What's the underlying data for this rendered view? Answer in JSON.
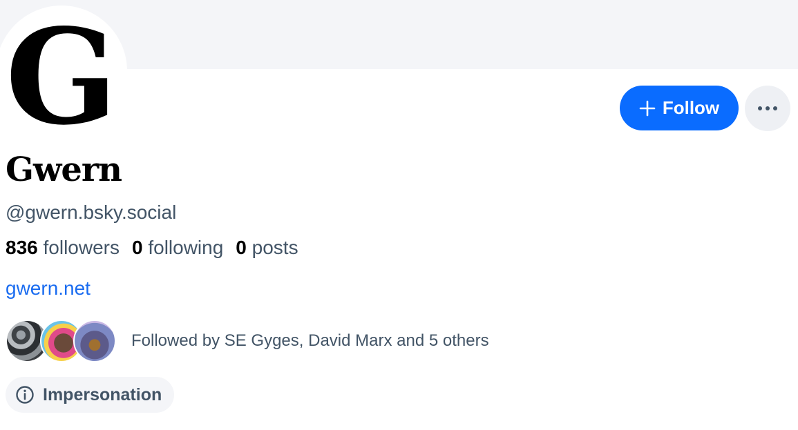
{
  "profile": {
    "display_name": "Gwern",
    "avatar_letter": "G",
    "handle": "@gwern.bsky.social",
    "website": "gwern.net"
  },
  "stats": {
    "followers_count": "836",
    "followers_label": "followers",
    "following_count": "0",
    "following_label": "following",
    "posts_count": "0",
    "posts_label": "posts"
  },
  "actions": {
    "follow_label": "Follow",
    "follow_icon": "plus-icon",
    "more_icon": "ellipsis-icon"
  },
  "known_followers": {
    "text": "Followed by SE Gyges, David Marx and 5 others",
    "avatar_count": 3
  },
  "moderation": {
    "label": "Impersonation",
    "icon": "info-icon"
  },
  "colors": {
    "accent": "#0a6cff",
    "link": "#1a6cf0",
    "muted_text": "#425466",
    "banner": "#f4f5f8"
  }
}
